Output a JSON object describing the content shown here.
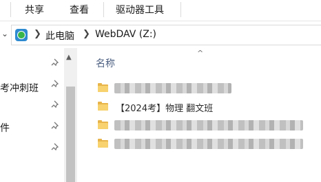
{
  "ribbon": {
    "tabs": [
      {
        "label": "共享"
      },
      {
        "label": "查看"
      },
      {
        "label": "驱动器工具"
      }
    ]
  },
  "address_bar": {
    "icon": "network-drive-icon",
    "crumbs": [
      "此电脑",
      "WebDAV (Z:)"
    ],
    "separator": ">"
  },
  "nav_pane": {
    "items": [
      {
        "label": ""
      },
      {
        "label": "考冲刺班"
      },
      {
        "label": ""
      },
      {
        "label": "件"
      },
      {
        "label": ""
      }
    ],
    "pin_icon": "pin-icon"
  },
  "content": {
    "column_header": "名称",
    "sort_indicator": "^",
    "rows": [
      {
        "visible_text": "",
        "redacted": true
      },
      {
        "visible_text": "  【2024考】物理  翻文班",
        "redacted": true
      },
      {
        "visible_text": "",
        "redacted": true
      },
      {
        "visible_text": "",
        "redacted": true
      }
    ]
  }
}
